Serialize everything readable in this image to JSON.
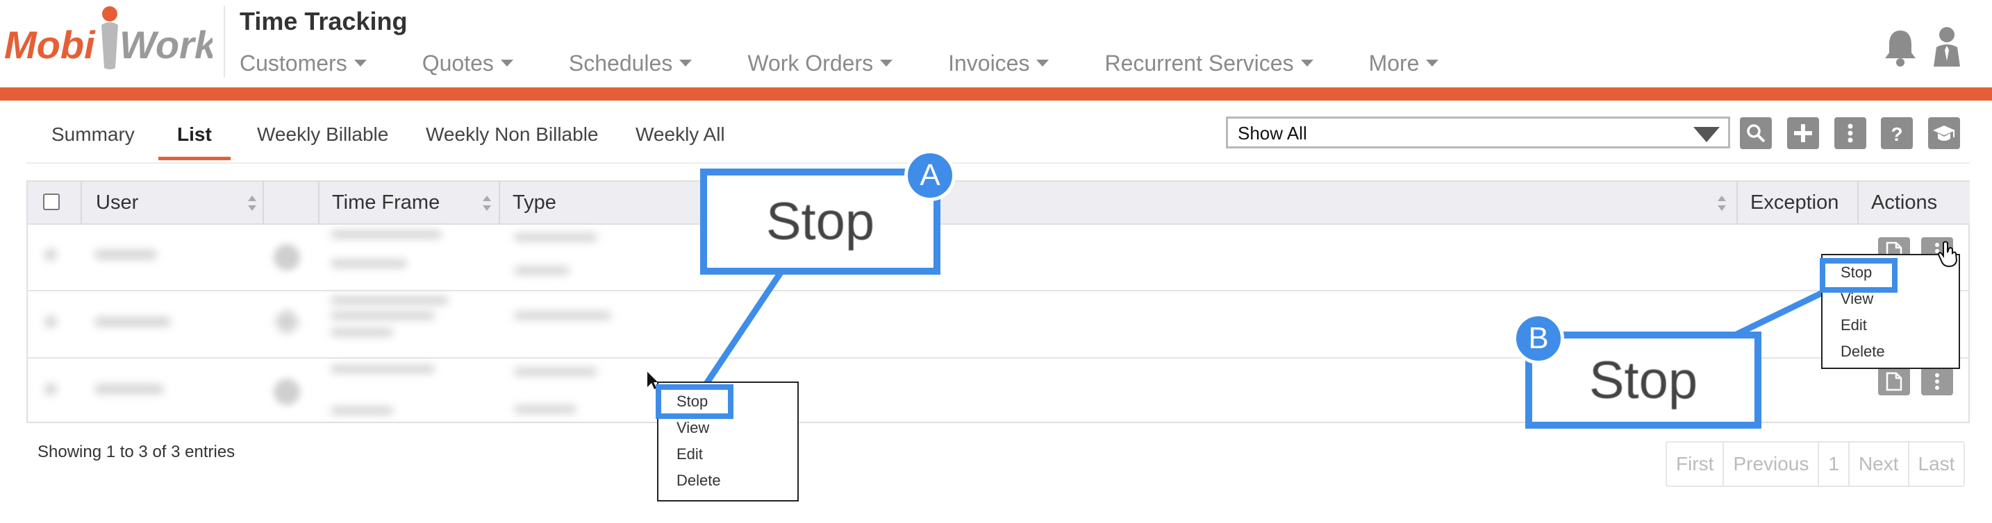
{
  "header": {
    "logo_text_left": "Mobi",
    "logo_text_right": "Work",
    "app_title": "Time Tracking",
    "nav": [
      {
        "label": "Customers"
      },
      {
        "label": "Quotes"
      },
      {
        "label": "Schedules"
      },
      {
        "label": "Work Orders"
      },
      {
        "label": "Invoices"
      },
      {
        "label": "Recurrent Services"
      },
      {
        "label": "More"
      }
    ],
    "icons": {
      "notifications": "bell-icon",
      "profile": "user-icon"
    },
    "accent_color": "#e55f36"
  },
  "tabs": [
    {
      "label": "Summary",
      "active": false
    },
    {
      "label": "List",
      "active": true
    },
    {
      "label": "Weekly Billable",
      "active": false
    },
    {
      "label": "Weekly Non Billable",
      "active": false
    },
    {
      "label": "Weekly All",
      "active": false
    }
  ],
  "toolbar": {
    "filter_value": "Show All",
    "buttons": [
      "search-icon",
      "plus-icon",
      "vertical-dots-icon",
      "help-icon",
      "graduation-cap-icon"
    ]
  },
  "table": {
    "columns": [
      "User",
      "Time Frame",
      "Type",
      "Exception",
      "Actions"
    ],
    "row_count": 3
  },
  "menu_a": {
    "items": [
      "Stop",
      "View",
      "Edit",
      "Delete"
    ],
    "highlighted": "Stop"
  },
  "menu_b": {
    "items": [
      "Stop",
      "View",
      "Edit",
      "Delete"
    ],
    "highlighted": "Stop"
  },
  "callouts": {
    "a": {
      "badge": "A",
      "text": "Stop"
    },
    "b": {
      "badge": "B",
      "text": "Stop"
    },
    "color": "#3f8de8"
  },
  "footer": {
    "entries_text": "Showing 1 to 3 of 3 entries",
    "pagination": [
      "First",
      "Previous",
      "1",
      "Next",
      "Last"
    ]
  }
}
